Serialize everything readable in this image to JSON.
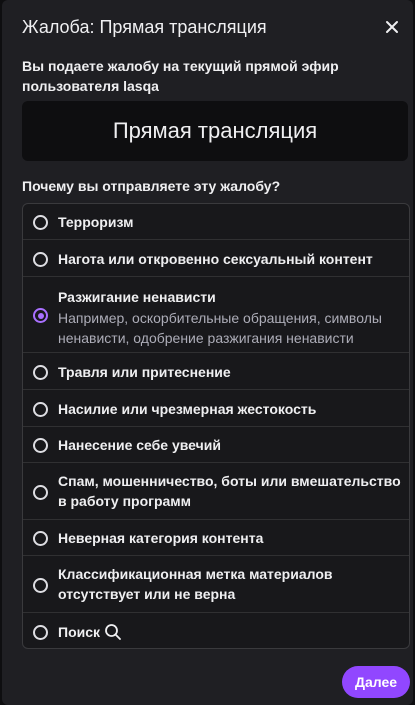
{
  "modal": {
    "title": "Жалоба: Прямая трансляция",
    "intro": "Вы подаете жалобу на текущий прямой эфир пользователя lasqa",
    "target": "Прямая трансляция",
    "question": "Почему вы отправляете эту жалобу?",
    "selected_index": 2,
    "accent_color": "#a970ff",
    "options": [
      {
        "label": "Терроризм"
      },
      {
        "label": "Нагота или откровенно сексуальный контент"
      },
      {
        "label": "Разжигание ненависти",
        "description": "Например, оскорбительные обращения, символы ненависти, одобрение разжигания ненависти"
      },
      {
        "label": "Травля или притеснение"
      },
      {
        "label": "Насилие или чрезмерная жестокость"
      },
      {
        "label": "Нанесение себе увечий"
      },
      {
        "label": "Спам, мошенничество, боты или вмешательство в работу программ"
      },
      {
        "label": "Неверная категория контента"
      },
      {
        "label": "Классификационная метка материалов отсутствует или не верна"
      },
      {
        "label": "Поиск",
        "icon": "search-icon"
      }
    ],
    "next_label": "Далее"
  }
}
